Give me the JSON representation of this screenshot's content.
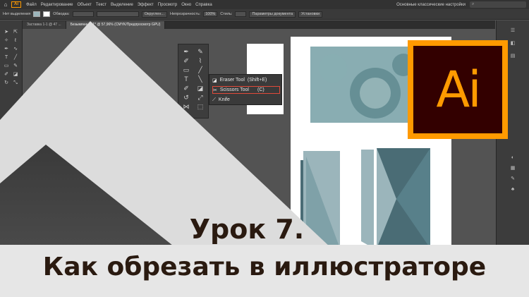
{
  "menubar": {
    "items": [
      "Файл",
      "Редактирование",
      "Объект",
      "Текст",
      "Выделение",
      "Эффект",
      "Просмотр",
      "Окно",
      "Справка"
    ],
    "workspace": "Основные классические настройки",
    "search_placeholder": ""
  },
  "controlbar": {
    "selection": "Нет выделения",
    "stroke_label": "Обводка:",
    "brush": "Округлен...",
    "opacity_label": "Непрозрачность:",
    "opacity_value": "100%",
    "style_label": "Стиль:",
    "doc_setup": "Параметры документа",
    "prefs": "Установки"
  },
  "tabs": [
    {
      "label": "Заставка 1-1 @ 47 ..."
    },
    {
      "label": "Безымянный-1* @ 57,96% (CMYK/Предпросмотр GPU)"
    }
  ],
  "flyout": {
    "eraser": {
      "label": "Eraser Tool",
      "shortcut": "(Shift+E)"
    },
    "scissors": {
      "label": "Scissors Tool",
      "shortcut": "(C)"
    },
    "knife": {
      "label": "Knife"
    }
  },
  "logo": {
    "text": "Ai"
  },
  "title": {
    "line1": "Урок 7.",
    "line2": "Как обрезать в иллюстраторе"
  },
  "colors": {
    "accent": "#ff9a00",
    "logo_bg": "#330000",
    "teal_dark": "#4a6c75",
    "teal_light": "#9bb5bb",
    "highlight": "#e04a3a"
  }
}
